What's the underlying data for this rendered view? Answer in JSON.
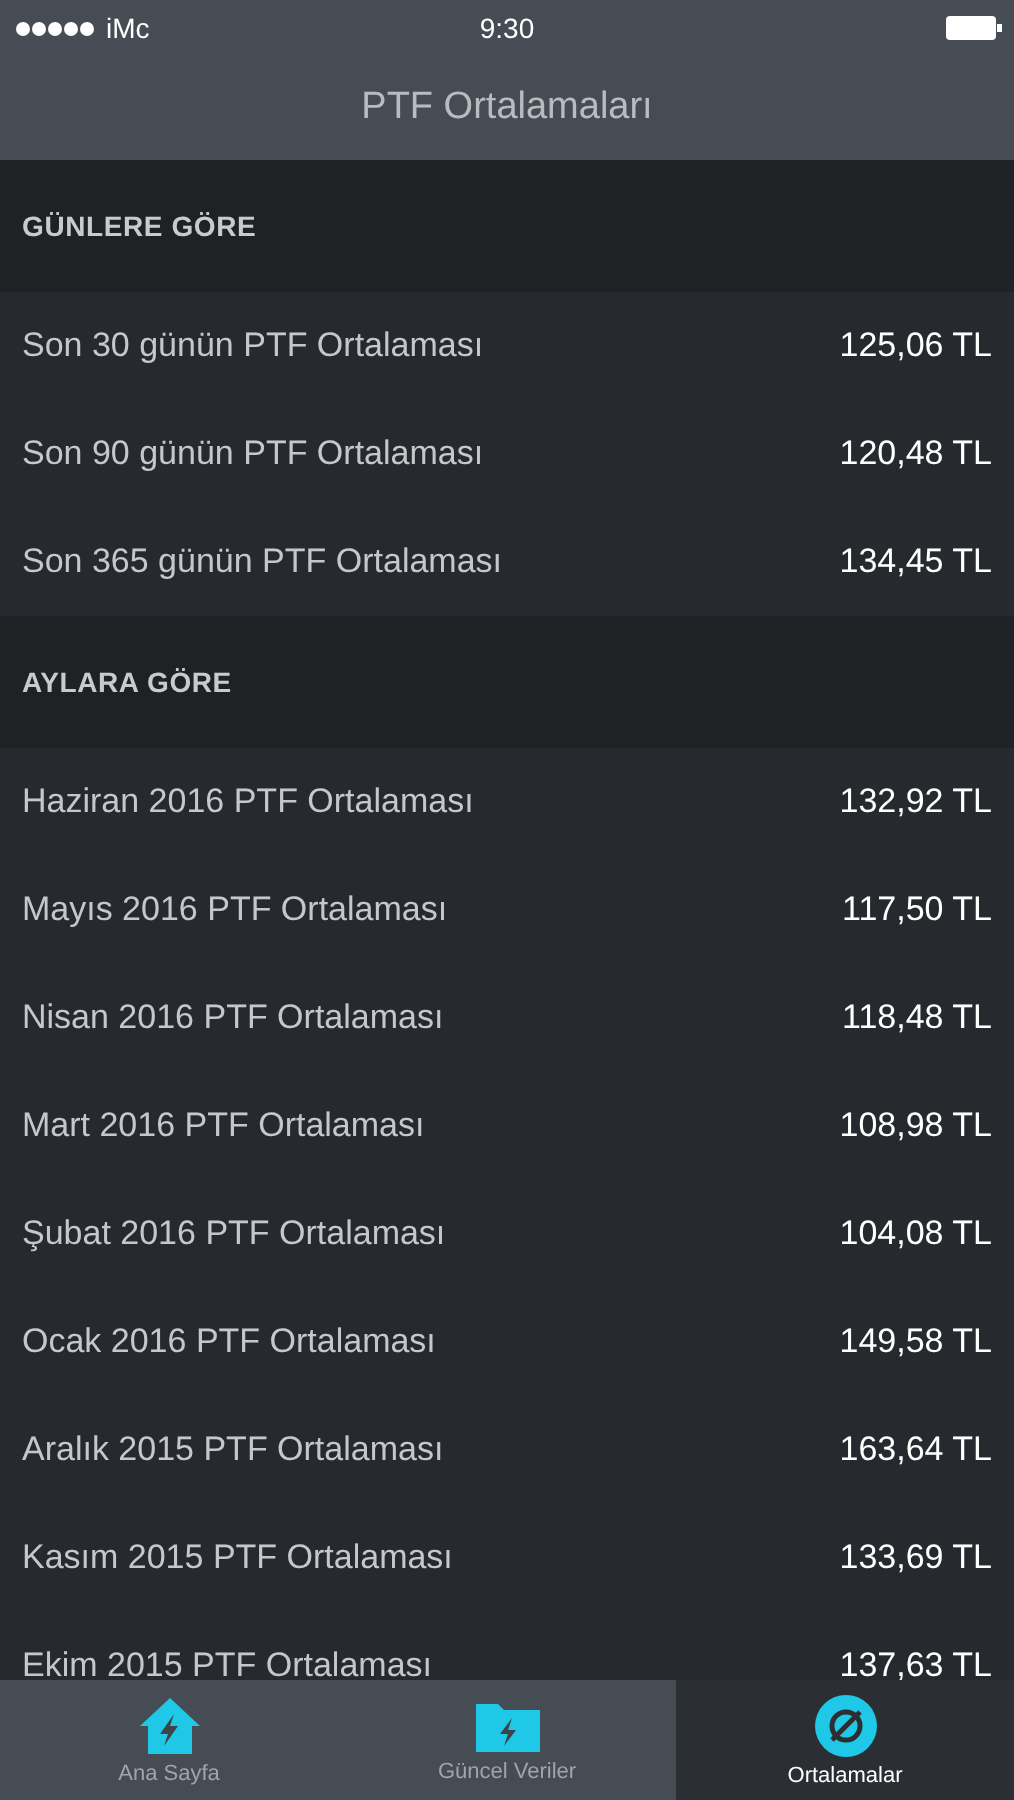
{
  "status_bar": {
    "carrier": "iMc",
    "time": "9:30"
  },
  "nav_bar": {
    "title": "PTF Ortalamaları"
  },
  "sections": [
    {
      "header": "GÜNLERE GÖRE",
      "rows": [
        {
          "label": "Son 30 günün PTF Ortalaması",
          "value": "125,06 TL"
        },
        {
          "label": "Son 90 günün PTF Ortalaması",
          "value": "120,48 TL"
        },
        {
          "label": "Son 365 günün PTF Ortalaması",
          "value": "134,45 TL"
        }
      ]
    },
    {
      "header": "AYLARA GÖRE",
      "rows": [
        {
          "label": "Haziran 2016 PTF Ortalaması",
          "value": "132,92 TL"
        },
        {
          "label": "Mayıs 2016 PTF Ortalaması",
          "value": "117,50 TL"
        },
        {
          "label": "Nisan 2016 PTF Ortalaması",
          "value": "118,48 TL"
        },
        {
          "label": "Mart 2016 PTF Ortalaması",
          "value": "108,98 TL"
        },
        {
          "label": "Şubat 2016 PTF Ortalaması",
          "value": "104,08 TL"
        },
        {
          "label": "Ocak 2016 PTF Ortalaması",
          "value": "149,58 TL"
        },
        {
          "label": "Aralık 2015 PTF Ortalaması",
          "value": "163,64 TL"
        },
        {
          "label": "Kasım 2015 PTF Ortalaması",
          "value": "133,69 TL"
        },
        {
          "label": "Ekim 2015 PTF Ortalaması",
          "value": "137,63 TL"
        }
      ]
    }
  ],
  "tab_bar": [
    {
      "kind": "home",
      "label": "Ana Sayfa",
      "selected": false
    },
    {
      "kind": "folder",
      "label": "Güncel Veriler",
      "selected": false
    },
    {
      "kind": "average",
      "label": "Ortalamalar",
      "selected": true
    }
  ]
}
